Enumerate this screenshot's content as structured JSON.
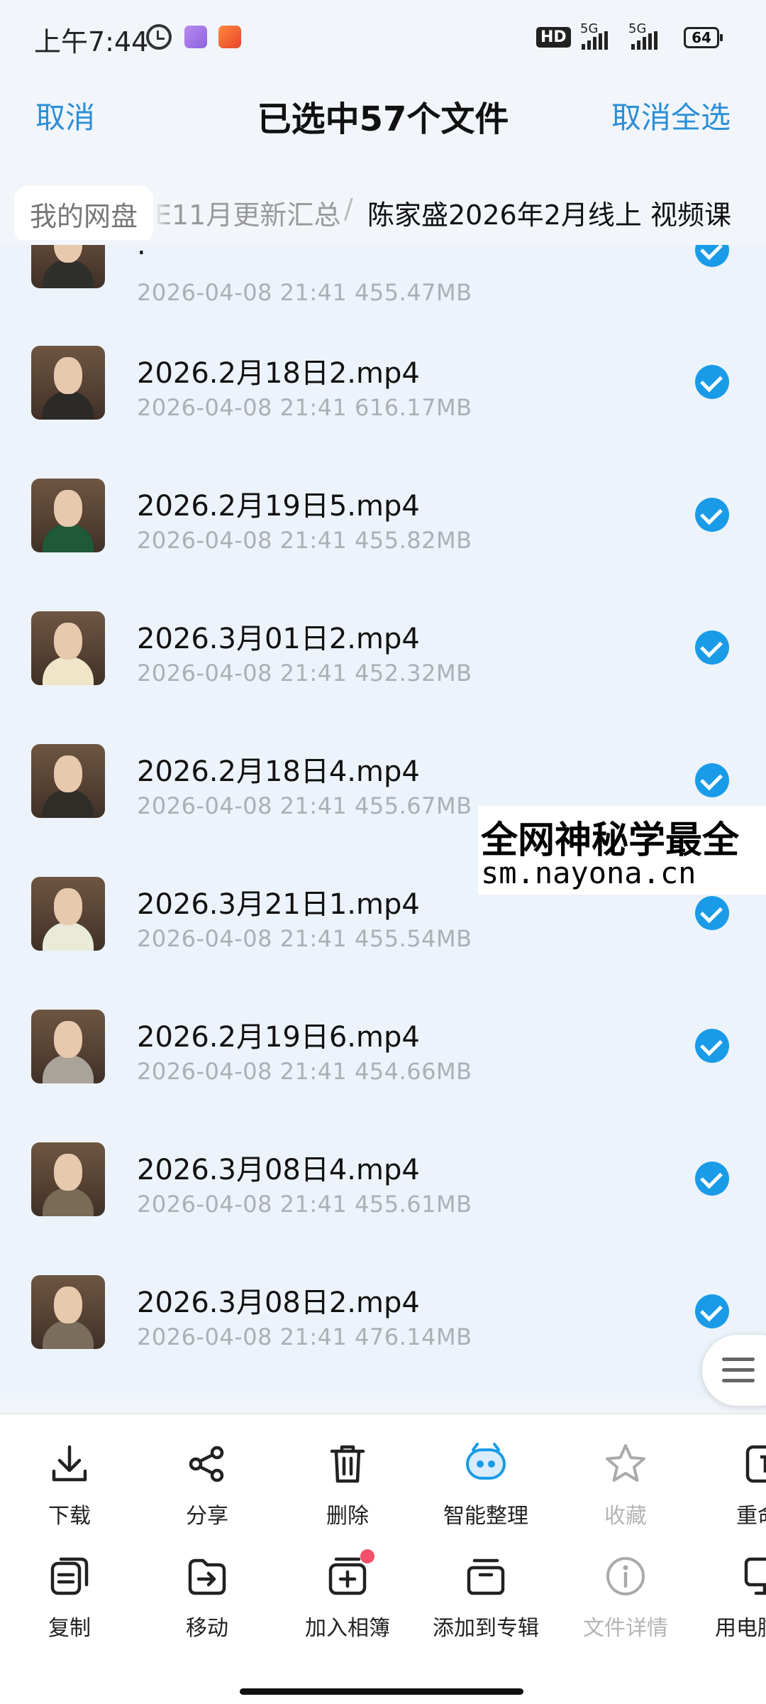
{
  "status_bar": {
    "time": "上午7:44",
    "hd_label": "HD",
    "signal1_label": "5G",
    "signal2_label": "5G",
    "battery": "64"
  },
  "header": {
    "cancel": "取消",
    "title": "已选中57个文件",
    "cancel_all": "取消全选"
  },
  "breadcrumb": {
    "root": "我的网盘",
    "middle": "E11月更新汇总",
    "separator": "/",
    "current": "陈家盛2026年2月线上 视频课"
  },
  "files": [
    {
      "name": ".",
      "date": "2026-04-08",
      "time": "21:41",
      "size": "455.47MB",
      "selected": true
    },
    {
      "name": "2026.2月18日2.mp4",
      "date": "2026-04-08",
      "time": "21:41",
      "size": "616.17MB",
      "selected": true
    },
    {
      "name": "2026.2月19日5.mp4",
      "date": "2026-04-08",
      "time": "21:41",
      "size": "455.82MB",
      "selected": true
    },
    {
      "name": "2026.3月01日2.mp4",
      "date": "2026-04-08",
      "time": "21:41",
      "size": "452.32MB",
      "selected": true
    },
    {
      "name": "2026.2月18日4.mp4",
      "date": "2026-04-08",
      "time": "21:41",
      "size": "455.67MB",
      "selected": true
    },
    {
      "name": "2026.3月21日1.mp4",
      "date": "2026-04-08",
      "time": "21:41",
      "size": "455.54MB",
      "selected": true
    },
    {
      "name": "2026.2月19日6.mp4",
      "date": "2026-04-08",
      "time": "21:41",
      "size": "454.66MB",
      "selected": true
    },
    {
      "name": "2026.3月08日4.mp4",
      "date": "2026-04-08",
      "time": "21:41",
      "size": "455.61MB",
      "selected": true
    },
    {
      "name": "2026.3月08日2.mp4",
      "date": "2026-04-08",
      "time": "21:41",
      "size": "476.14MB",
      "selected": true
    }
  ],
  "watermark": {
    "line1": "全网神秘学最全",
    "line2": "sm.nayona.cn"
  },
  "toolbar": {
    "row1": [
      {
        "label": "下载",
        "icon": "download-icon"
      },
      {
        "label": "分享",
        "icon": "share-icon"
      },
      {
        "label": "删除",
        "icon": "trash-icon"
      },
      {
        "label": "智能整理",
        "icon": "smart-organize-icon"
      },
      {
        "label": "收藏",
        "icon": "star-icon"
      },
      {
        "label": "重命",
        "icon": "rename-icon"
      }
    ],
    "row2": [
      {
        "label": "复制",
        "icon": "copy-icon"
      },
      {
        "label": "移动",
        "icon": "move-icon"
      },
      {
        "label": "加入相簿",
        "icon": "add-album-icon"
      },
      {
        "label": "添加到专辑",
        "icon": "add-to-collection-icon"
      },
      {
        "label": "文件详情",
        "icon": "info-icon"
      },
      {
        "label": "用电脑",
        "icon": "computer-icon"
      }
    ]
  },
  "colors": {
    "accent": "#2c8fd8",
    "check": "#1a9be8",
    "list_bg": "#ecf3fa",
    "badge": "#f2506b"
  }
}
